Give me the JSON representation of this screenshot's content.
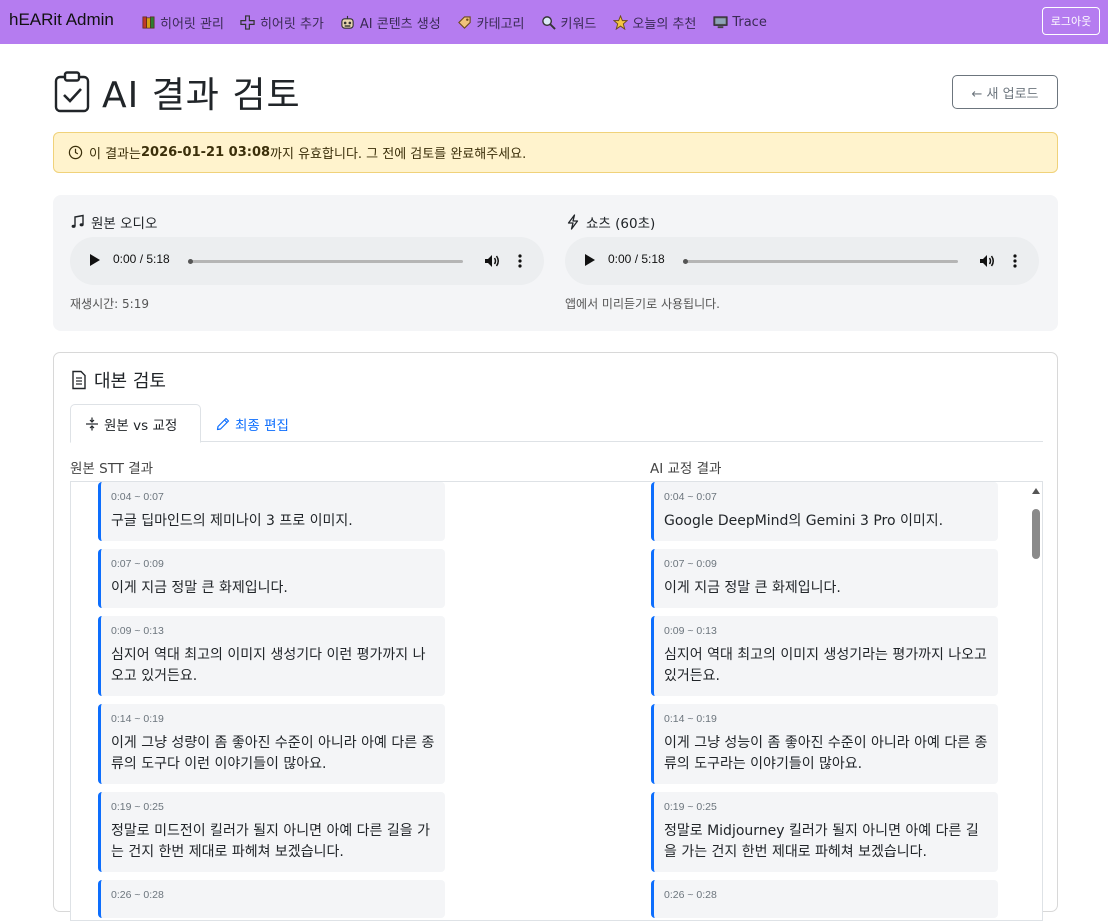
{
  "nav": {
    "brand": "hEARit Admin",
    "items": [
      {
        "label": "히어릿 관리",
        "icon": "books-icon"
      },
      {
        "label": "히어릿 추가",
        "icon": "plus-icon"
      },
      {
        "label": "AI 콘텐츠 생성",
        "icon": "robot-icon"
      },
      {
        "label": "카테고리",
        "icon": "tag-icon"
      },
      {
        "label": "키워드",
        "icon": "magnifier-icon"
      },
      {
        "label": "오늘의 추천",
        "icon": "star-icon"
      },
      {
        "label": "Trace",
        "icon": "monitor-icon"
      }
    ],
    "logout_label": "로그아웃"
  },
  "header": {
    "title": "AI 결과 검토",
    "upload_button": "← 새 업로드"
  },
  "alert": {
    "prefix": "이 결과는 ",
    "expiry": "2026-01-21 03:08",
    "suffix": "까지 유효합니다. 그 전에 검토를 완료해주세요."
  },
  "audio": {
    "original": {
      "label": "원본 오디오",
      "time": "0:00 / 5:18",
      "progress": 0,
      "note": "재생시간: 5:19"
    },
    "shorts": {
      "label": "쇼츠 (60초)",
      "time": "0:00 / 5:18",
      "progress": 0,
      "note": "앱에서 미리듣기로 사용됩니다."
    }
  },
  "script": {
    "title": "대본 검토",
    "tabs": {
      "compare": "원본 vs 교정",
      "final": "최종 편집"
    },
    "left_header": "원본 STT 결과",
    "right_header": "AI 교정 결과",
    "original_segments": [
      {
        "time": "0:04 ~ 0:07",
        "text": "구글 딥마인드의 제미나이 3 프로 이미지."
      },
      {
        "time": "0:07 ~ 0:09",
        "text": "이게 지금 정말 큰 화제입니다."
      },
      {
        "time": "0:09 ~ 0:13",
        "text": "심지어 역대 최고의 이미지 생성기다 이런 평가까지 나오고 있거든요."
      },
      {
        "time": "0:14 ~ 0:19",
        "text": "이게 그냥 성량이 좀 좋아진 수준이 아니라 아예 다른 종류의 도구다 이런 이야기들이 많아요."
      },
      {
        "time": "0:19 ~ 0:25",
        "text": "정말로 미드전이 킬러가 될지 아니면 아예 다른 길을 가는 건지 한번 제대로 파헤쳐 보겠습니다."
      },
      {
        "time": "0:26 ~ 0:28",
        "text": ""
      }
    ],
    "corrected_segments": [
      {
        "time": "0:04 ~ 0:07",
        "text": "Google DeepMind의 Gemini 3 Pro 이미지."
      },
      {
        "time": "0:07 ~ 0:09",
        "text": "이게 지금 정말 큰 화제입니다."
      },
      {
        "time": "0:09 ~ 0:13",
        "text": "심지어 역대 최고의 이미지 생성기라는 평가까지 나오고 있거든요."
      },
      {
        "time": "0:14 ~ 0:19",
        "text": "이게 그냥 성능이 좀 좋아진 수준이 아니라 아예 다른 종류의 도구라는 이야기들이 많아요."
      },
      {
        "time": "0:19 ~ 0:25",
        "text": "정말로 Midjourney 킬러가 될지 아니면 아예 다른 길을 가는 건지 한번 제대로 파헤쳐 보겠습니다."
      },
      {
        "time": "0:26 ~ 0:28",
        "text": ""
      }
    ]
  }
}
